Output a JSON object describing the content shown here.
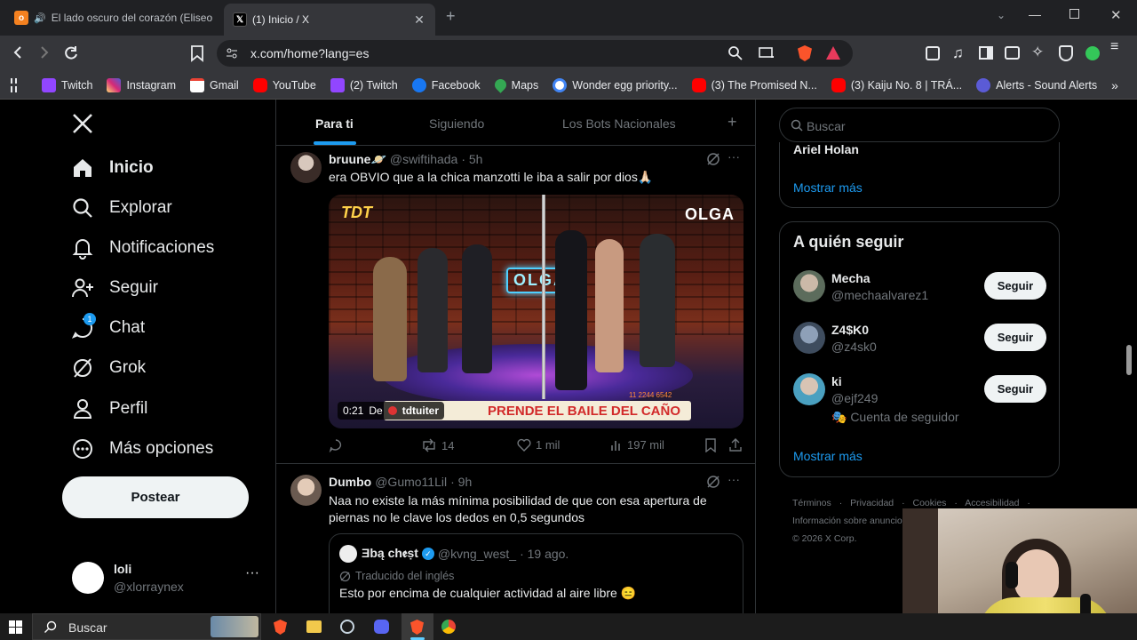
{
  "browser": {
    "tabs": [
      {
        "title": "El lado oscuro del corazón (Eliseo",
        "active": false
      },
      {
        "title": "(1) Inicio / X",
        "active": true
      }
    ],
    "url": "x.com/home?lang=es",
    "bookmarks": [
      {
        "label": "Twitch",
        "icon": "twitch-icon",
        "color": "#9146ff"
      },
      {
        "label": "Instagram",
        "icon": "instagram-icon",
        "color": "#d62976"
      },
      {
        "label": "Gmail",
        "icon": "gmail-icon",
        "color": "#ea4335"
      },
      {
        "label": "YouTube",
        "icon": "youtube-icon",
        "color": "#ff0000"
      },
      {
        "label": "(2) Twitch",
        "icon": "twitch-icon",
        "color": "#9146ff"
      },
      {
        "label": "Facebook",
        "icon": "facebook-icon",
        "color": "#1877f2"
      },
      {
        "label": "Maps",
        "icon": "maps-icon",
        "color": "#34a853"
      },
      {
        "label": "Wonder egg priority...",
        "icon": "google-icon",
        "color": "#ffffff"
      },
      {
        "label": "(3) The Promised N...",
        "icon": "youtube-icon",
        "color": "#ff0000"
      },
      {
        "label": "(3) Kaiju No. 8 | TRÁ...",
        "icon": "youtube-icon",
        "color": "#ff0000"
      },
      {
        "label": "Alerts - Sound Alerts",
        "icon": "soundalerts-icon",
        "color": "#5b5bd6"
      }
    ]
  },
  "sidebar": {
    "nav": [
      {
        "label": "Inicio",
        "icon": "home-icon"
      },
      {
        "label": "Explorar",
        "icon": "search-icon"
      },
      {
        "label": "Notificaciones",
        "icon": "bell-icon"
      },
      {
        "label": "Seguir",
        "icon": "add-person-icon"
      },
      {
        "label": "Chat",
        "icon": "chat-icon",
        "badge": "1"
      },
      {
        "label": "Grok",
        "icon": "grok-icon"
      },
      {
        "label": "Perfil",
        "icon": "person-icon"
      },
      {
        "label": "Más opciones",
        "icon": "more-circle-icon"
      }
    ],
    "post_button": "Postear",
    "account": {
      "name": "loli",
      "handle": "@xlorraynex"
    }
  },
  "feed": {
    "tabs": [
      "Para ti",
      "Siguiendo",
      "Los Bots Nacionales"
    ],
    "tweet1": {
      "name": "bruune🪐",
      "handle": "@swiftihada",
      "time": "· 5h",
      "text": "era OBVIO que a la chica manzotti le iba a salir por dios🙏🏻",
      "video": {
        "duration": "0:21",
        "from_label": "De",
        "from_account": "tdtuiter",
        "logo_left": "TDT",
        "logo_right": "OLGA",
        "caption": "PRENDE EL BAILE DEL CAÑO",
        "stage_sign": "OLGA",
        "counter": "11 2244 6542"
      },
      "stats": {
        "retweets": "14",
        "likes": "1 mil",
        "views": "197 mil"
      }
    },
    "tweet2": {
      "name": "Dumbo",
      "handle": "@Gumo11Lil",
      "time": "· 9h",
      "text": "Naa no existe la más mínima posibilidad de que con esa apertura de piernas no le clave los dedos en 0,5 segundos",
      "quote": {
        "name": "Ǝbą ch𝖊ṣt",
        "handle": "@kvng_west_",
        "time": "· 19 ago.",
        "translated": "Traducido del inglés",
        "text": "Esto por encima de cualquier actividad al aire libre 😑"
      }
    }
  },
  "right": {
    "search_placeholder": "Buscar",
    "trend_name": "Ariel Holan",
    "show_more": "Mostrar más",
    "who_to_follow_title": "A quién seguir",
    "who_to_follow": [
      {
        "name": "Mecha",
        "handle": "@mechaalvarez1",
        "button": "Seguir"
      },
      {
        "name": "Z4$K0",
        "handle": "@z4sk0",
        "button": "Seguir"
      },
      {
        "name": "ki",
        "handle": "@ejf249",
        "button": "Seguir",
        "note": "🎭 Cuenta de seguidor"
      }
    ],
    "footer": [
      "Términos",
      "Privacidad",
      "Cookies",
      "Accesibilidad",
      "Información sobre anuncios",
      "© 2026 X Corp."
    ]
  },
  "taskbar": {
    "search_label": "Buscar"
  },
  "colors": {
    "accent": "#1d9bf0",
    "border": "#2f3336",
    "muted": "#71767b"
  }
}
